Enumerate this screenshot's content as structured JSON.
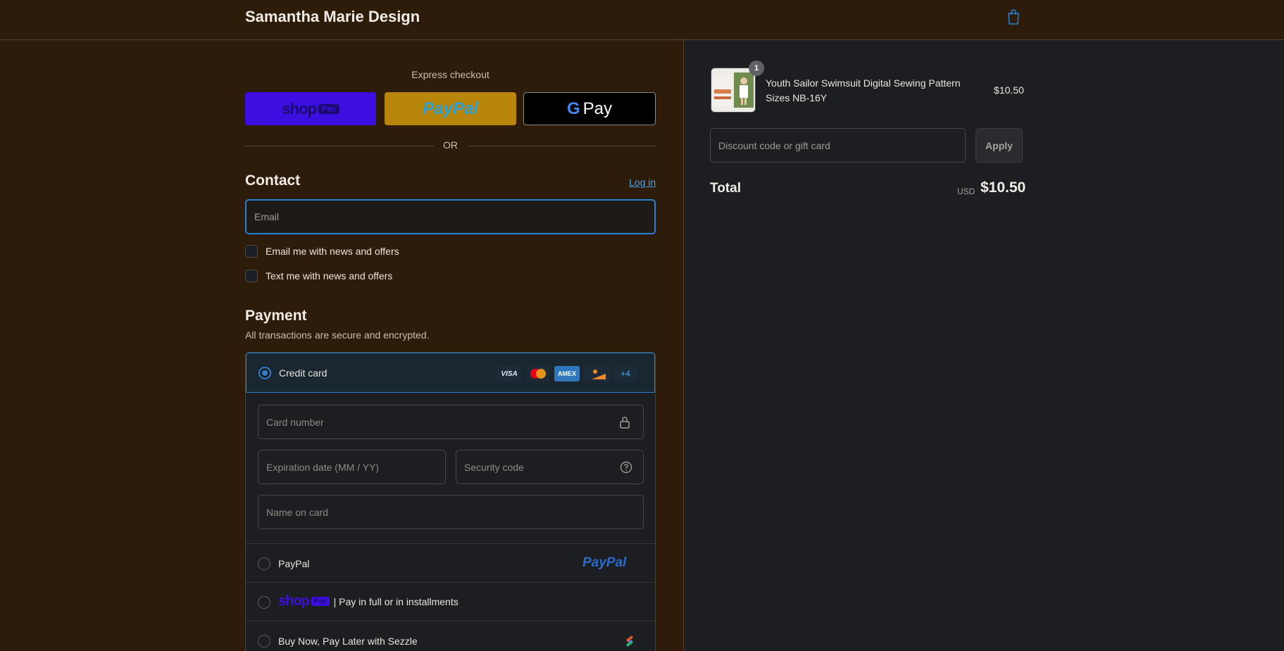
{
  "header": {
    "store_name": "Samantha Marie Design",
    "cart_icon": "shopping-bag-icon"
  },
  "express": {
    "label": "Express checkout",
    "shop_pay_word": "shop",
    "shop_pay_pill": "Pay",
    "paypal_label": "PayPal",
    "gpay_g": "G",
    "gpay_label": "Pay",
    "or_label": "OR"
  },
  "contact": {
    "title": "Contact",
    "login_label": "Log in",
    "email_placeholder": "Email",
    "email_opt_in": "Email me with news and offers",
    "text_opt_in": "Text me with news and offers"
  },
  "payment": {
    "title": "Payment",
    "subtitle": "All transactions are secure and encrypted.",
    "credit_card": {
      "label": "Credit card",
      "badges": [
        "VISA",
        "AMEX",
        "+4"
      ],
      "card_number_placeholder": "Card number",
      "expiry_placeholder": "Expiration date (MM / YY)",
      "security_placeholder": "Security code",
      "name_placeholder": "Name on card"
    },
    "options": [
      {
        "label": "PayPal",
        "logo": "PayPal"
      },
      {
        "label": "| Pay in full or in installments",
        "logo_word": "shop",
        "logo_pill": "Pay"
      },
      {
        "label": "Buy Now, Pay Later with Sezzle",
        "icon": "sezzle-icon"
      }
    ]
  },
  "order": {
    "item": {
      "quantity": "1",
      "name": "Youth Sailor Swimsuit Digital Sewing Pattern Sizes NB-16Y",
      "price": "$10.50"
    },
    "discount_placeholder": "Discount code or gift card",
    "apply_label": "Apply",
    "total_label": "Total",
    "currency": "USD",
    "total_value": "$10.50"
  },
  "colors": {
    "left_background": "#2d1c0a",
    "right_background": "#1d1e21",
    "accent": "#2b7fd1",
    "shop_pay": "#3c0fe0",
    "paypal_button": "#b8860b"
  }
}
